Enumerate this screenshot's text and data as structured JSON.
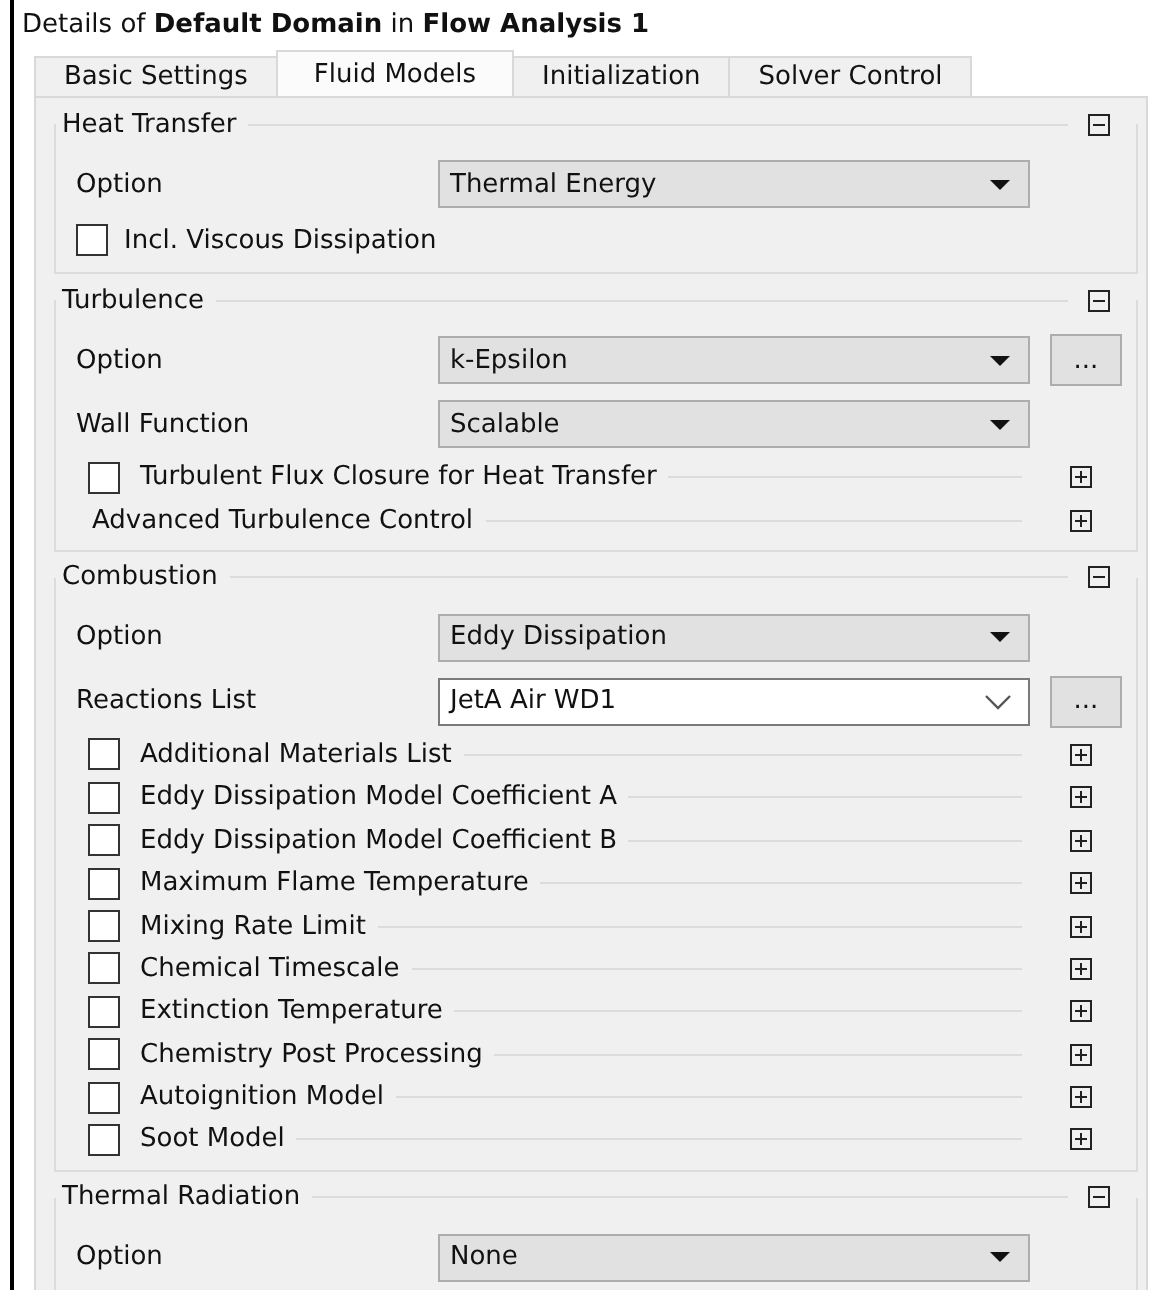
{
  "title": "Details of **Default Domain** in **Flow Analysis 1**",
  "tabs": [
    {
      "label": "Basic Settings",
      "selected": false
    },
    {
      "label": "Fluid Models",
      "selected": true
    },
    {
      "label": "Initialization",
      "selected": false
    },
    {
      "label": "Solver Control",
      "selected": false
    }
  ],
  "sections": [
    {
      "title": "Heat Transfer",
      "expanded": true,
      "rows": [
        {
          "kind": "dropdown",
          "label": "Option",
          "value": "Thermal Energy"
        },
        {
          "kind": "checkbox",
          "label": "Incl. Viscous Dissipation",
          "checked": false
        }
      ]
    },
    {
      "title": "Turbulence",
      "expanded": true,
      "rows": [
        {
          "kind": "dropdown",
          "label": "Option",
          "value": "k-Epsilon",
          "more": "..."
        },
        {
          "kind": "dropdown",
          "label": "Wall Function",
          "value": "Scalable"
        },
        {
          "kind": "check_subsection",
          "label": "Turbulent Flux Closure for Heat Transfer",
          "checked": false,
          "expanded": false
        },
        {
          "kind": "subsection",
          "label": "Advanced Turbulence Control",
          "expanded": false
        }
      ]
    },
    {
      "title": "Combustion",
      "expanded": true,
      "rows": [
        {
          "kind": "dropdown",
          "label": "Option",
          "value": "Eddy Dissipation"
        },
        {
          "kind": "combo",
          "label": "Reactions List",
          "value": "JetA Air WD1",
          "more": "..."
        },
        {
          "kind": "check_subsection",
          "label": "Additional Materials List",
          "checked": false,
          "expanded": false
        },
        {
          "kind": "check_subsection",
          "label": "Eddy Dissipation Model Coefficient A",
          "checked": false,
          "expanded": false
        },
        {
          "kind": "check_subsection",
          "label": "Eddy Dissipation Model Coefficient B",
          "checked": false,
          "expanded": false
        },
        {
          "kind": "check_subsection",
          "label": "Maximum Flame Temperature",
          "checked": false,
          "expanded": false
        },
        {
          "kind": "check_subsection",
          "label": "Mixing Rate Limit",
          "checked": false,
          "expanded": false
        },
        {
          "kind": "check_subsection",
          "label": "Chemical Timescale",
          "checked": false,
          "expanded": false
        },
        {
          "kind": "check_subsection",
          "label": "Extinction Temperature",
          "checked": false,
          "expanded": false
        },
        {
          "kind": "check_subsection",
          "label": "Chemistry Post Processing",
          "checked": false,
          "expanded": false
        },
        {
          "kind": "check_subsection",
          "label": "Autoignition Model",
          "checked": false,
          "expanded": false
        },
        {
          "kind": "check_subsection",
          "label": "Soot Model",
          "checked": false,
          "expanded": false
        }
      ]
    },
    {
      "title": "Thermal Radiation",
      "expanded": true,
      "rows": [
        {
          "kind": "dropdown",
          "label": "Option",
          "value": "None"
        }
      ]
    }
  ]
}
